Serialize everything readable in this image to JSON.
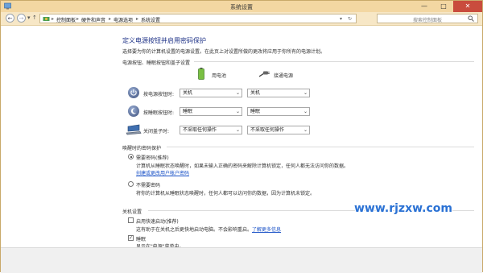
{
  "window": {
    "title": "系统设置"
  },
  "address": {
    "crumbs": [
      "控制面板",
      "硬件和声音",
      "电源选项",
      "系统设置"
    ],
    "search_placeholder": "搜索控制面板"
  },
  "page": {
    "title": "定义电源按钮并启用密码保护",
    "description": "选择要为你的计算机设置的电源设置。在此页上对设置所做的更改将应用于你所有的电源计划。",
    "section_buttons": "电源按钮、睡眠按钮和盖子设置",
    "col_battery": "用电池",
    "col_plugged": "接通电源",
    "rows": [
      {
        "label": "按电源按钮时:",
        "battery": "关机",
        "plugged": "关机"
      },
      {
        "label": "按睡眠按钮时:",
        "battery": "睡眠",
        "plugged": "睡眠"
      },
      {
        "label": "关闭盖子时:",
        "battery": "不采取任何操作",
        "plugged": "不采取任何操作"
      }
    ],
    "section_password": "唤醒时的密码保护",
    "option_require": "需要密码(推荐)",
    "option_require_desc": "计算机从睡眠状态唤醒时，如果未输入正确的密码来解除计算机锁定，任何人都无法访问你的数据。",
    "option_require_link": "创建或更改用户帐户密码",
    "option_norequire": "不需要密码",
    "option_norequire_desc": "将你的计算机从睡眠状态唤醒时，任何人都可以访问你的数据，因为计算机未锁定。",
    "section_shutdown": "关机设置",
    "fast_startup": "启用快速启动(推荐)",
    "fast_startup_desc": "这有助于在关机之后更快地启动电脑。不会影响重启。",
    "fast_startup_link": "了解更多信息",
    "sleep": "睡眠",
    "sleep_desc": "显示在\"电源\"菜单中。"
  },
  "watermark": "www.rjzxw.com",
  "colors": {
    "titlebar": "#f3d7a2",
    "heading": "#1e3287",
    "link": "#1a52c7",
    "close": "#c94c3d"
  }
}
